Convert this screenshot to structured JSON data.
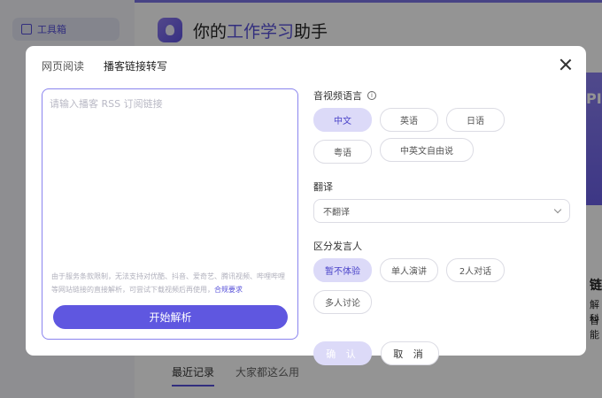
{
  "background": {
    "sidebar_item": "工具箱",
    "title_prefix": "你的",
    "title_accent": "工作学习",
    "title_suffix": "助手",
    "tabs": [
      "最近记录",
      "大家都这么用"
    ],
    "banner_text": "PI",
    "right_texts": [
      "链",
      "解科",
      "智能"
    ]
  },
  "modal": {
    "tabs": [
      "网页阅读",
      "播客链接转写"
    ],
    "input_placeholder": "请输入播客 RSS 订阅链接",
    "notice": "由于服务条款限制，无法支持对优酷、抖音、爱奇艺、腾讯视频、哔哩哔哩等网站链接的直接解析，可尝试下载视频后再使用，",
    "notice_link": "合规要求",
    "start_button": "开始解析",
    "language": {
      "label": "音视频语言",
      "options": [
        "中文",
        "英语",
        "日语",
        "粤语",
        "中英文自由说"
      ],
      "selected": "中文"
    },
    "translation": {
      "label": "翻译",
      "value": "不翻译"
    },
    "speaker": {
      "label": "区分发言人",
      "options": [
        "暂不体验",
        "单人演讲",
        "2人对话",
        "多人讨论"
      ],
      "selected": "暂不体验"
    },
    "confirm": "确 认",
    "cancel": "取 消"
  }
}
